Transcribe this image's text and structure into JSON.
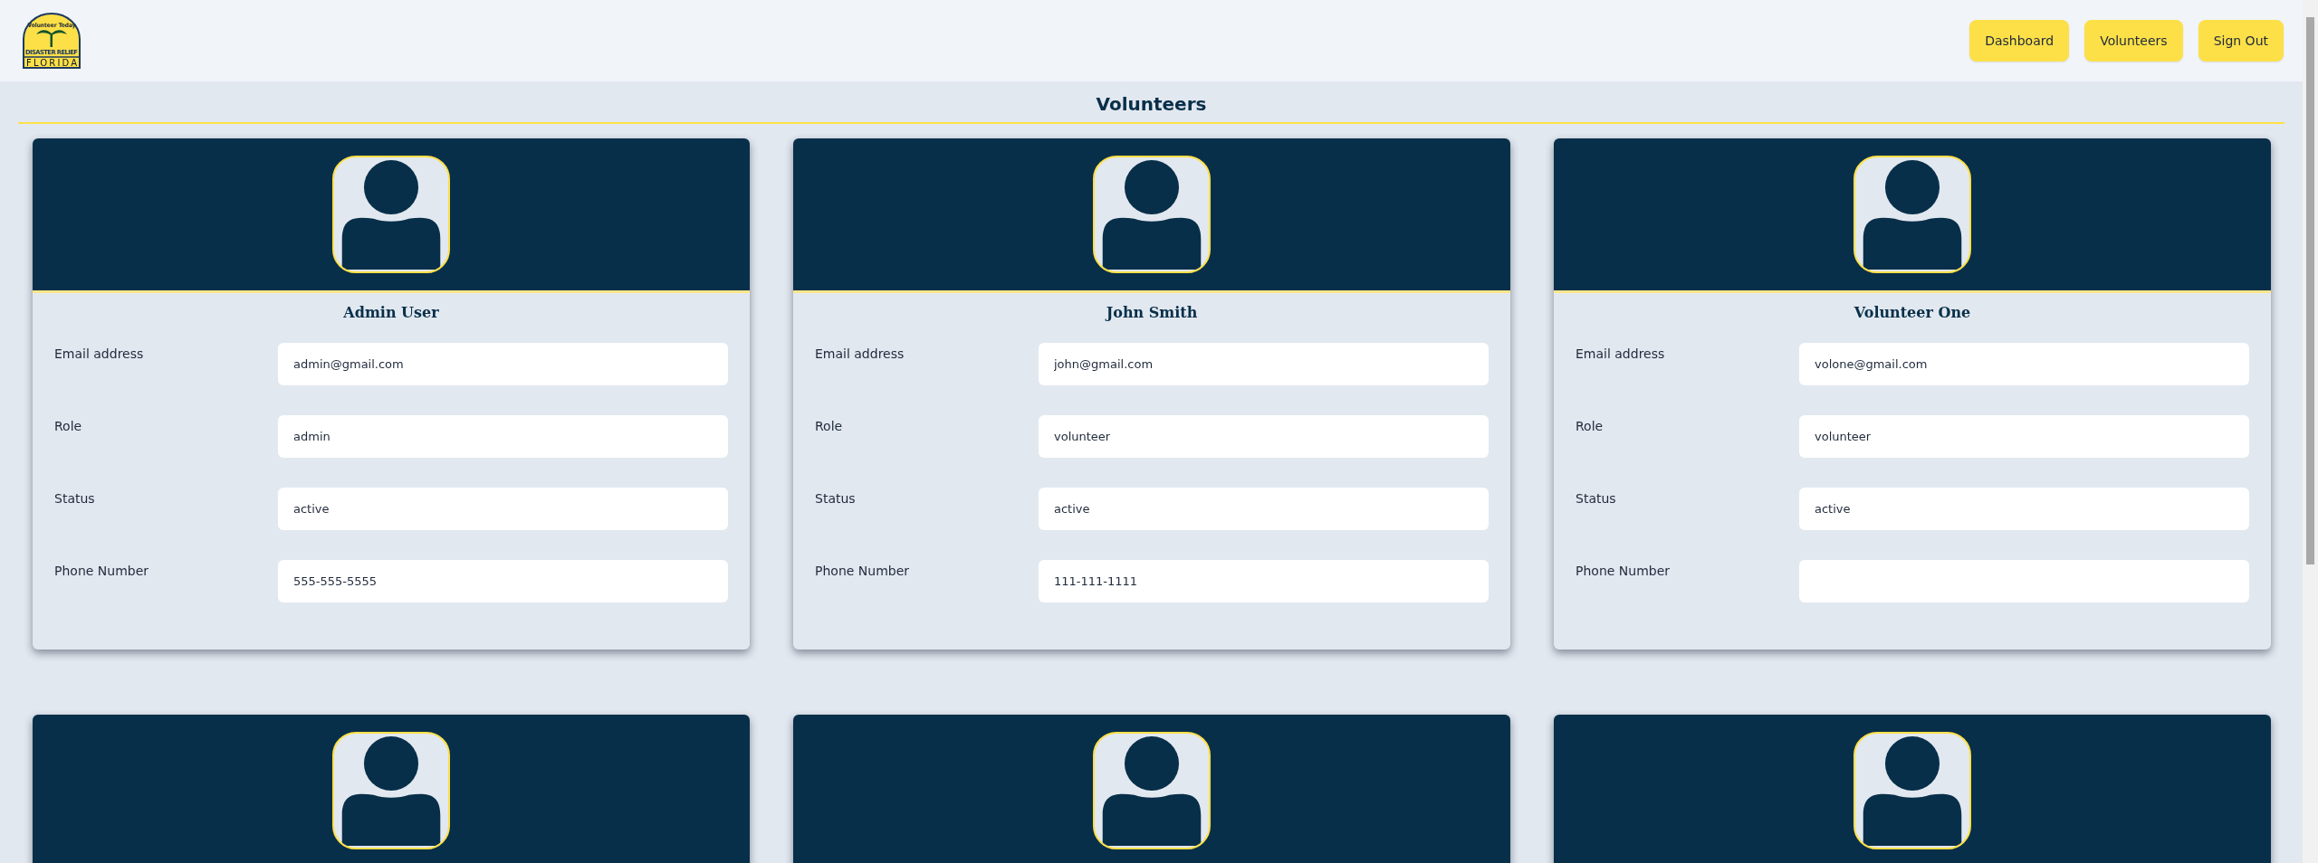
{
  "logo": {
    "top": "Volunteer Today",
    "middle": "DISASTER RELIEF",
    "bottom": "FLORIDA"
  },
  "nav": [
    "Dashboard",
    "Volunteers",
    "Sign Out"
  ],
  "page_title": "Volunteers",
  "volunteers": [
    {
      "kind": "full",
      "name": "Admin User",
      "fields": [
        {
          "label": "Email address",
          "value": "admin@gmail.com"
        },
        {
          "label": "Role",
          "value": "admin"
        },
        {
          "label": "Status",
          "value": "active"
        },
        {
          "label": "Phone Number",
          "value": "555-555-5555"
        }
      ]
    },
    {
      "kind": "full",
      "name": "John Smith",
      "fields": [
        {
          "label": "Email address",
          "value": "john@gmail.com"
        },
        {
          "label": "Role",
          "value": "volunteer"
        },
        {
          "label": "Status",
          "value": "active"
        },
        {
          "label": "Phone Number",
          "value": "111-111-1111"
        }
      ]
    },
    {
      "kind": "full",
      "name": "Volunteer One",
      "fields": [
        {
          "label": "Email address",
          "value": "volone@gmail.com"
        },
        {
          "label": "Role",
          "value": "volunteer"
        },
        {
          "label": "Status",
          "value": "active"
        },
        {
          "label": "Phone Number"
        }
      ]
    },
    {
      "kind": "cut"
    },
    {
      "kind": "cut"
    },
    {
      "kind": "cut"
    }
  ]
}
